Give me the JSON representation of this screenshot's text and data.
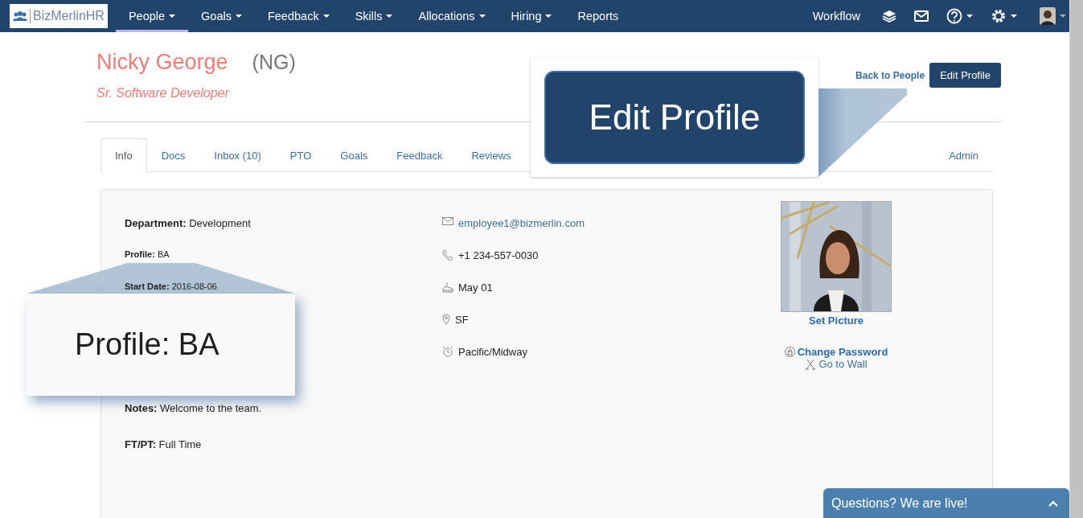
{
  "nav": {
    "logo": "BizMerlinHR",
    "items": [
      {
        "label": "People",
        "dropdown": true,
        "selected": true
      },
      {
        "label": "Goals",
        "dropdown": true,
        "selected": false
      },
      {
        "label": "Feedback",
        "dropdown": true,
        "selected": false
      },
      {
        "label": "Skills",
        "dropdown": true,
        "selected": false
      },
      {
        "label": "Allocations",
        "dropdown": true,
        "selected": false
      },
      {
        "label": "Hiring",
        "dropdown": true,
        "selected": false
      },
      {
        "label": "Reports",
        "dropdown": false,
        "selected": false
      }
    ],
    "workflow": "Workflow"
  },
  "header": {
    "name": "Nicky George",
    "initials": "(NG)",
    "title": "Sr. Software Developer",
    "back_link": "Back to People",
    "edit_button": "Edit Profile"
  },
  "tabs": [
    {
      "label": "Info",
      "selected": true
    },
    {
      "label": "Docs",
      "selected": false
    },
    {
      "label": "Inbox (10)",
      "selected": false
    },
    {
      "label": "PTO",
      "selected": false
    },
    {
      "label": "Goals",
      "selected": false
    },
    {
      "label": "Feedback",
      "selected": false
    },
    {
      "label": "Reviews",
      "selected": false
    },
    {
      "label": "Admin",
      "selected": false
    }
  ],
  "details": [
    {
      "label": "Department:",
      "value": "Development",
      "kind": "large"
    },
    {
      "label": "Profile:",
      "value": "BA",
      "kind": "small"
    },
    {
      "label": "Start Date:",
      "value": "2016-08-06",
      "kind": "small"
    },
    {
      "label": "Notes:",
      "value": "Welcome to the team.",
      "kind": "large"
    },
    {
      "label": "FT/PT:",
      "value": "Full Time",
      "kind": "large"
    }
  ],
  "contact": [
    {
      "kind": "email",
      "text": "employee1@bizmerlin.com"
    },
    {
      "kind": "phone",
      "text": "+1 234-557-0030"
    },
    {
      "kind": "birthday",
      "text": "May 01"
    },
    {
      "kind": "location",
      "text": "SF"
    },
    {
      "kind": "timezone",
      "text": "Pacific/Midway"
    }
  ],
  "photo_card": {
    "set_picture": "Set Picture",
    "change_password": "Change Password",
    "go_to_wall": "Go to Wall"
  },
  "callouts": [
    {
      "kind": "button",
      "text": "Edit Profile"
    },
    {
      "kind": "text",
      "text": "Profile: BA"
    }
  ],
  "chat": {
    "text": "Questions? We are live!"
  }
}
